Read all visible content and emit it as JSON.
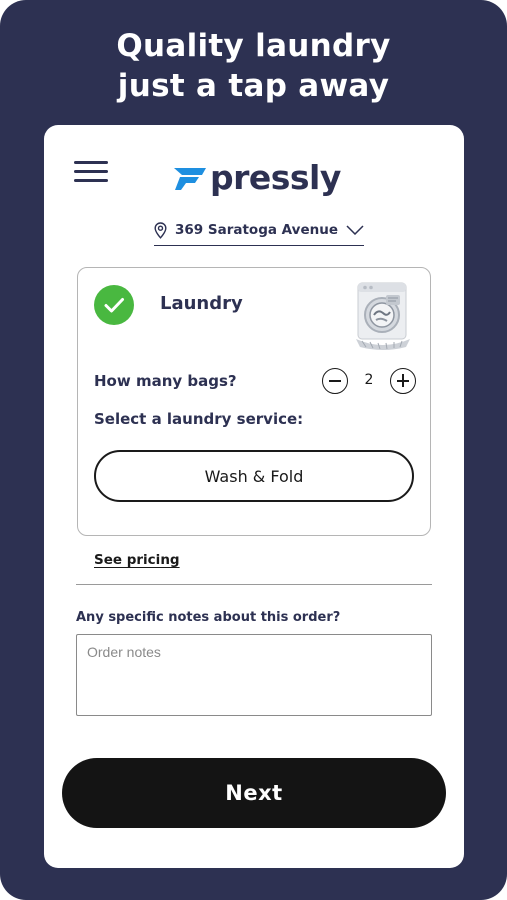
{
  "promo": {
    "headline_line1": "Quality laundry",
    "headline_line2": "just a tap away"
  },
  "header": {
    "menu_icon": "hamburger-menu-icon",
    "logo_icon": "pressly-logo-mark",
    "logo_text": "pressly"
  },
  "address": {
    "pin_icon": "location-pin-icon",
    "value": "369 Saratoga Avenue",
    "chevron_icon": "chevron-down-icon"
  },
  "service": {
    "selected": true,
    "check_icon": "checkmark-icon",
    "name": "Laundry",
    "image": "washing-machine-illustration",
    "bags_label": "How many bags?",
    "bags_count": "2",
    "select_label": "Select a laundry service:",
    "option_label": "Wash & Fold"
  },
  "pricing": {
    "link_label": "See pricing"
  },
  "notes": {
    "label": "Any specific notes about this order?",
    "placeholder": "Order notes",
    "value": ""
  },
  "footer": {
    "next_label": "Next"
  },
  "colors": {
    "background": "#2d3152",
    "logo_blue": "#1e8fe0",
    "check_green": "#49b840",
    "button_dark": "#141414"
  }
}
